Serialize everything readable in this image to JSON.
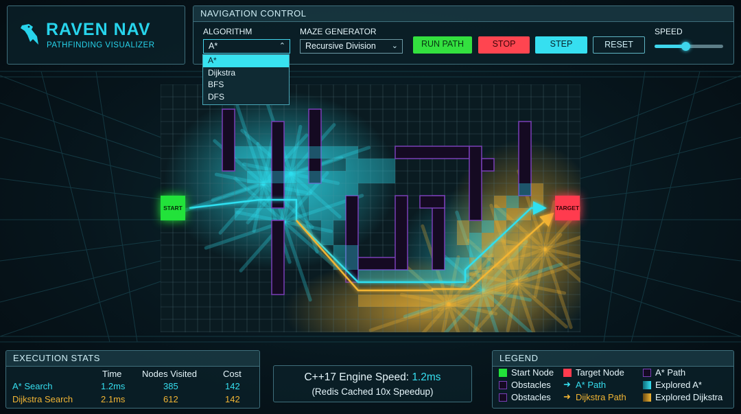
{
  "app": {
    "title": "RAVEN NAV",
    "subtitle": "PATHFINDING VISUALIZER"
  },
  "nav": {
    "title": "NAVIGATION CONTROL",
    "algorithm_label": "ALGORITHM",
    "algorithm_value": "A*",
    "algorithm_options": [
      "A*",
      "Dijkstra",
      "BFS",
      "DFS"
    ],
    "maze_label": "MAZE GENERATOR",
    "maze_value": "Recursive Division",
    "run_label": "RUN PATH",
    "stop_label": "STOP",
    "step_label": "STEP",
    "reset_label": "RESET",
    "speed_label": "SPEED",
    "speed_fraction": 0.45
  },
  "maze": {
    "start_label": "START",
    "target_label": "TARGET",
    "cols": 17,
    "rows": 10,
    "colors": {
      "astar": "#2fe0f0",
      "dijkstra": "#f2b534",
      "wall": "#7a3fb8",
      "start": "#22e23a",
      "target": "#ff3b4e"
    }
  },
  "stats": {
    "title": "EXECUTION STATS",
    "headers": [
      "Time",
      "Nodes Visited",
      "Cost"
    ],
    "rows": [
      {
        "name": "A* Search",
        "time": "1.2ms",
        "nodes": "385",
        "cost": "142"
      },
      {
        "name": "Dijkstra Search",
        "time": "2.1ms",
        "nodes": "612",
        "cost": "142"
      }
    ]
  },
  "engine": {
    "line1_prefix": "C++17 Engine Speed: ",
    "line1_value": "1.2ms",
    "line2": "(Redis Cached 10x Speedup)"
  },
  "legend": {
    "title": "LEGEND",
    "items": {
      "start": "Start Node",
      "target": "Target Node",
      "astar_path_box": "A* Path",
      "obstacles_1": "Obstacles",
      "astar_path_arrow": "A* Path",
      "explored_astar": "Explored A*",
      "obstacles_2": "Obstacles",
      "dijkstra_path": "Dijkstra Path",
      "explored_dijkstra": "Explored Dijkstra"
    }
  }
}
